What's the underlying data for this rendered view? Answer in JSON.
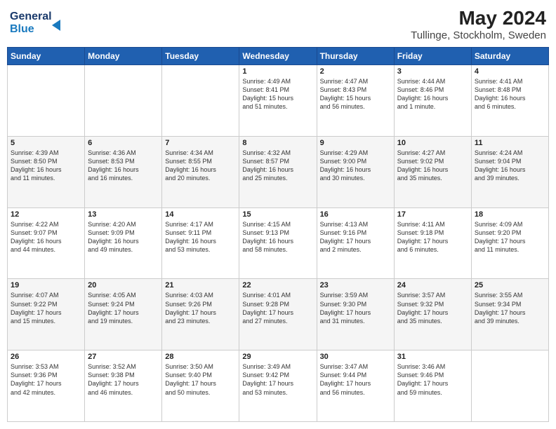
{
  "header": {
    "logo_line1": "General",
    "logo_line2": "Blue",
    "title": "May 2024",
    "subtitle": "Tullinge, Stockholm, Sweden"
  },
  "weekdays": [
    "Sunday",
    "Monday",
    "Tuesday",
    "Wednesday",
    "Thursday",
    "Friday",
    "Saturday"
  ],
  "weeks": [
    [
      {
        "day": "",
        "detail": ""
      },
      {
        "day": "",
        "detail": ""
      },
      {
        "day": "",
        "detail": ""
      },
      {
        "day": "1",
        "detail": "Sunrise: 4:49 AM\nSunset: 8:41 PM\nDaylight: 15 hours\nand 51 minutes."
      },
      {
        "day": "2",
        "detail": "Sunrise: 4:47 AM\nSunset: 8:43 PM\nDaylight: 15 hours\nand 56 minutes."
      },
      {
        "day": "3",
        "detail": "Sunrise: 4:44 AM\nSunset: 8:46 PM\nDaylight: 16 hours\nand 1 minute."
      },
      {
        "day": "4",
        "detail": "Sunrise: 4:41 AM\nSunset: 8:48 PM\nDaylight: 16 hours\nand 6 minutes."
      }
    ],
    [
      {
        "day": "5",
        "detail": "Sunrise: 4:39 AM\nSunset: 8:50 PM\nDaylight: 16 hours\nand 11 minutes."
      },
      {
        "day": "6",
        "detail": "Sunrise: 4:36 AM\nSunset: 8:53 PM\nDaylight: 16 hours\nand 16 minutes."
      },
      {
        "day": "7",
        "detail": "Sunrise: 4:34 AM\nSunset: 8:55 PM\nDaylight: 16 hours\nand 20 minutes."
      },
      {
        "day": "8",
        "detail": "Sunrise: 4:32 AM\nSunset: 8:57 PM\nDaylight: 16 hours\nand 25 minutes."
      },
      {
        "day": "9",
        "detail": "Sunrise: 4:29 AM\nSunset: 9:00 PM\nDaylight: 16 hours\nand 30 minutes."
      },
      {
        "day": "10",
        "detail": "Sunrise: 4:27 AM\nSunset: 9:02 PM\nDaylight: 16 hours\nand 35 minutes."
      },
      {
        "day": "11",
        "detail": "Sunrise: 4:24 AM\nSunset: 9:04 PM\nDaylight: 16 hours\nand 39 minutes."
      }
    ],
    [
      {
        "day": "12",
        "detail": "Sunrise: 4:22 AM\nSunset: 9:07 PM\nDaylight: 16 hours\nand 44 minutes."
      },
      {
        "day": "13",
        "detail": "Sunrise: 4:20 AM\nSunset: 9:09 PM\nDaylight: 16 hours\nand 49 minutes."
      },
      {
        "day": "14",
        "detail": "Sunrise: 4:17 AM\nSunset: 9:11 PM\nDaylight: 16 hours\nand 53 minutes."
      },
      {
        "day": "15",
        "detail": "Sunrise: 4:15 AM\nSunset: 9:13 PM\nDaylight: 16 hours\nand 58 minutes."
      },
      {
        "day": "16",
        "detail": "Sunrise: 4:13 AM\nSunset: 9:16 PM\nDaylight: 17 hours\nand 2 minutes."
      },
      {
        "day": "17",
        "detail": "Sunrise: 4:11 AM\nSunset: 9:18 PM\nDaylight: 17 hours\nand 6 minutes."
      },
      {
        "day": "18",
        "detail": "Sunrise: 4:09 AM\nSunset: 9:20 PM\nDaylight: 17 hours\nand 11 minutes."
      }
    ],
    [
      {
        "day": "19",
        "detail": "Sunrise: 4:07 AM\nSunset: 9:22 PM\nDaylight: 17 hours\nand 15 minutes."
      },
      {
        "day": "20",
        "detail": "Sunrise: 4:05 AM\nSunset: 9:24 PM\nDaylight: 17 hours\nand 19 minutes."
      },
      {
        "day": "21",
        "detail": "Sunrise: 4:03 AM\nSunset: 9:26 PM\nDaylight: 17 hours\nand 23 minutes."
      },
      {
        "day": "22",
        "detail": "Sunrise: 4:01 AM\nSunset: 9:28 PM\nDaylight: 17 hours\nand 27 minutes."
      },
      {
        "day": "23",
        "detail": "Sunrise: 3:59 AM\nSunset: 9:30 PM\nDaylight: 17 hours\nand 31 minutes."
      },
      {
        "day": "24",
        "detail": "Sunrise: 3:57 AM\nSunset: 9:32 PM\nDaylight: 17 hours\nand 35 minutes."
      },
      {
        "day": "25",
        "detail": "Sunrise: 3:55 AM\nSunset: 9:34 PM\nDaylight: 17 hours\nand 39 minutes."
      }
    ],
    [
      {
        "day": "26",
        "detail": "Sunrise: 3:53 AM\nSunset: 9:36 PM\nDaylight: 17 hours\nand 42 minutes."
      },
      {
        "day": "27",
        "detail": "Sunrise: 3:52 AM\nSunset: 9:38 PM\nDaylight: 17 hours\nand 46 minutes."
      },
      {
        "day": "28",
        "detail": "Sunrise: 3:50 AM\nSunset: 9:40 PM\nDaylight: 17 hours\nand 50 minutes."
      },
      {
        "day": "29",
        "detail": "Sunrise: 3:49 AM\nSunset: 9:42 PM\nDaylight: 17 hours\nand 53 minutes."
      },
      {
        "day": "30",
        "detail": "Sunrise: 3:47 AM\nSunset: 9:44 PM\nDaylight: 17 hours\nand 56 minutes."
      },
      {
        "day": "31",
        "detail": "Sunrise: 3:46 AM\nSunset: 9:46 PM\nDaylight: 17 hours\nand 59 minutes."
      },
      {
        "day": "",
        "detail": ""
      }
    ]
  ]
}
